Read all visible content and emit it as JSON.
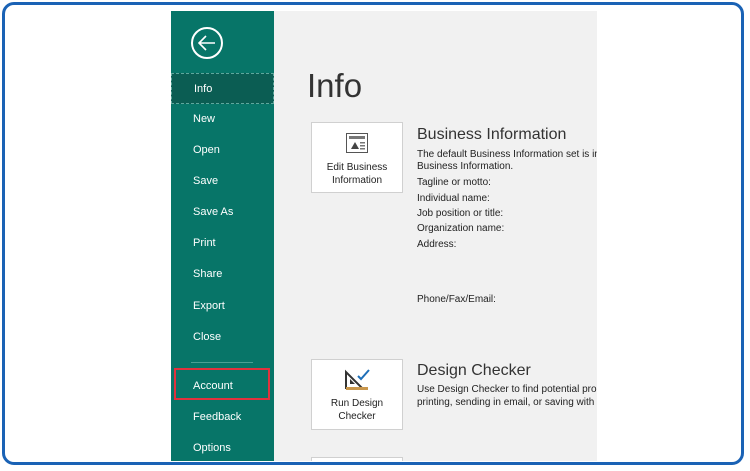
{
  "nav": {
    "items": [
      {
        "label": "Info"
      },
      {
        "label": "New"
      },
      {
        "label": "Open"
      },
      {
        "label": "Save"
      },
      {
        "label": "Save As"
      },
      {
        "label": "Print"
      },
      {
        "label": "Share"
      },
      {
        "label": "Export"
      },
      {
        "label": "Close"
      },
      {
        "label": "Account"
      },
      {
        "label": "Feedback"
      },
      {
        "label": "Options"
      }
    ],
    "active": "Info",
    "highlighted": "Account"
  },
  "page": {
    "title": "Info"
  },
  "business": {
    "tile_line1": "Edit Business",
    "tile_line2": "Information",
    "heading": "Business Information",
    "description_line1": "The default Business Information set is in",
    "description_line2": "Business Information.",
    "fields": [
      "Tagline or motto:",
      "Individual name:",
      "Job position or title:",
      "Organization name:",
      "Address:",
      "Phone/Fax/Email:"
    ]
  },
  "design": {
    "tile_line1": "Run Design",
    "tile_line2": "Checker",
    "heading": "Design Checker",
    "description_line1": "Use Design Checker to find potential prob",
    "description_line2": "printing, sending in email, or saving with"
  },
  "colors": {
    "sidebar": "#077568",
    "highlight": "#e0323d",
    "frame": "#1a62b5"
  }
}
